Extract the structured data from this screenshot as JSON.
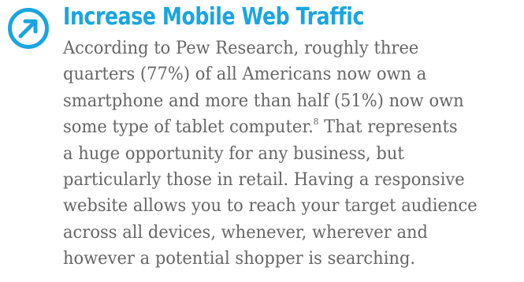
{
  "heading": "Increase Mobile Web Traffic",
  "icon": "arrow-up-right-circle-icon",
  "accent_color": "#1aa5e0",
  "text_color": "#666666",
  "paragraph": {
    "line_1": "According to Pew Research, roughly three",
    "line_2": "quarters (77%) of all Americans now own a",
    "line_3": "smartphone and more than half (51%) now own",
    "line_4_before": "some type of tablet computer.",
    "footnote_ref": "8",
    "line_4_after": " That represents",
    "line_5": "a huge opportunity for any business, but",
    "line_6": "particularly those in retail. Having a responsive",
    "line_7": "website allows you to reach your target audience",
    "line_8": "across all devices, whenever, wherever and",
    "line_9": "however a potential shopper is searching."
  }
}
